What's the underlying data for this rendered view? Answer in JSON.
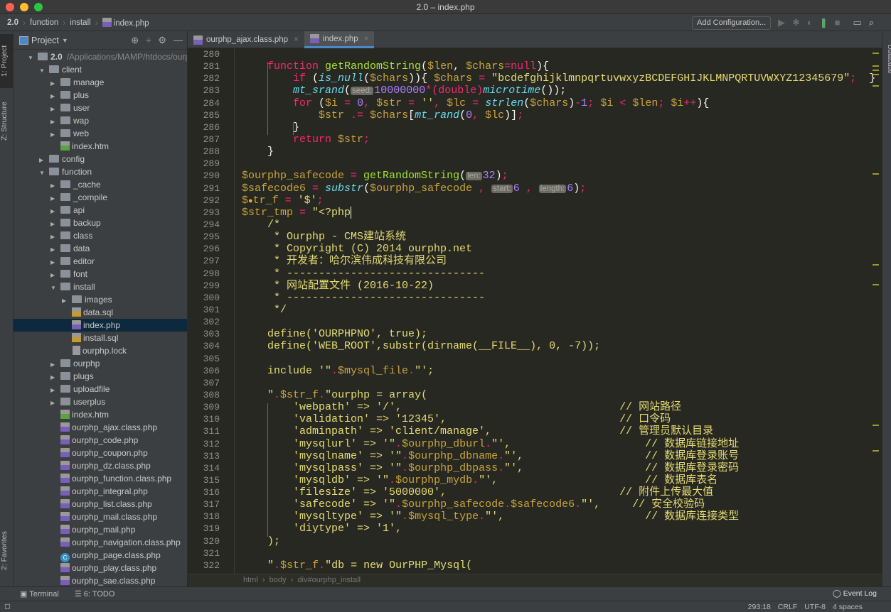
{
  "window": {
    "title": "2.0 – index.php",
    "lights": [
      "#ff5f57",
      "#febc2e",
      "#28c840"
    ]
  },
  "navbar": {
    "crumbs": [
      "2.0",
      "function",
      "install",
      "index.php"
    ],
    "add_configuration": "Add Configuration...",
    "icons": [
      "run-icon",
      "debug-icon",
      "coverage-icon",
      "database-sync-icon",
      "stop-icon",
      "terminal-window-icon",
      "search-icon"
    ]
  },
  "left_stripe": {
    "project": "1: Project",
    "structure": "Z: Structure",
    "favorites": "2: Favorites"
  },
  "right_stripe": {
    "database": "Database"
  },
  "project": {
    "title": "Project",
    "tree": [
      {
        "level": 0,
        "type": "folder",
        "open": true,
        "name": "2.0",
        "path": "/Applications/MAMP/htdocs/ourp"
      },
      {
        "level": 1,
        "type": "folder",
        "open": true,
        "name": "client"
      },
      {
        "level": 2,
        "type": "folder",
        "open": false,
        "name": "manage"
      },
      {
        "level": 2,
        "type": "folder",
        "open": false,
        "name": "plus"
      },
      {
        "level": 2,
        "type": "folder",
        "open": false,
        "name": "user"
      },
      {
        "level": 2,
        "type": "folder",
        "open": false,
        "name": "wap"
      },
      {
        "level": 2,
        "type": "folder",
        "open": false,
        "name": "web"
      },
      {
        "level": 2,
        "type": "htm",
        "name": "index.htm"
      },
      {
        "level": 1,
        "type": "folder",
        "open": false,
        "name": "config"
      },
      {
        "level": 1,
        "type": "folder",
        "open": true,
        "name": "function"
      },
      {
        "level": 2,
        "type": "folder",
        "open": false,
        "name": "_cache"
      },
      {
        "level": 2,
        "type": "folder",
        "open": false,
        "name": "_compile"
      },
      {
        "level": 2,
        "type": "folder",
        "open": false,
        "name": "api"
      },
      {
        "level": 2,
        "type": "folder",
        "open": false,
        "name": "backup"
      },
      {
        "level": 2,
        "type": "folder",
        "open": false,
        "name": "class"
      },
      {
        "level": 2,
        "type": "folder",
        "open": false,
        "name": "data"
      },
      {
        "level": 2,
        "type": "folder",
        "open": false,
        "name": "editor"
      },
      {
        "level": 2,
        "type": "folder",
        "open": false,
        "name": "font"
      },
      {
        "level": 2,
        "type": "folder",
        "open": true,
        "name": "install"
      },
      {
        "level": 3,
        "type": "folder",
        "open": false,
        "name": "images"
      },
      {
        "level": 3,
        "type": "sql",
        "name": "data.sql"
      },
      {
        "level": 3,
        "type": "php",
        "name": "index.php",
        "selected": true
      },
      {
        "level": 3,
        "type": "sql",
        "name": "install.sql"
      },
      {
        "level": 3,
        "type": "file",
        "name": "ourphp.lock"
      },
      {
        "level": 2,
        "type": "folder",
        "open": false,
        "name": "ourphp"
      },
      {
        "level": 2,
        "type": "folder",
        "open": false,
        "name": "plugs"
      },
      {
        "level": 2,
        "type": "folder",
        "open": false,
        "name": "uploadfile"
      },
      {
        "level": 2,
        "type": "folder",
        "open": false,
        "name": "userplus"
      },
      {
        "level": 2,
        "type": "htm",
        "name": "index.htm"
      },
      {
        "level": 2,
        "type": "php",
        "name": "ourphp_ajax.class.php"
      },
      {
        "level": 2,
        "type": "php",
        "name": "ourphp_code.php"
      },
      {
        "level": 2,
        "type": "php",
        "name": "ourphp_coupon.php"
      },
      {
        "level": 2,
        "type": "php",
        "name": "ourphp_dz.class.php"
      },
      {
        "level": 2,
        "type": "php",
        "name": "ourphp_function.class.php"
      },
      {
        "level": 2,
        "type": "php",
        "name": "ourphp_integral.php"
      },
      {
        "level": 2,
        "type": "php",
        "name": "ourphp_list.class.php"
      },
      {
        "level": 2,
        "type": "php",
        "name": "ourphp_mail.class.php"
      },
      {
        "level": 2,
        "type": "php",
        "name": "ourphp_mail.php"
      },
      {
        "level": 2,
        "type": "php",
        "name": "ourphp_navigation.class.php"
      },
      {
        "level": 2,
        "type": "class",
        "name": "ourphp_page.class.php"
      },
      {
        "level": 2,
        "type": "php",
        "name": "ourphp_play.class.php"
      },
      {
        "level": 2,
        "type": "php",
        "name": "ourphp_sae.class.php"
      }
    ]
  },
  "tabs": [
    {
      "label": "ourphp_ajax.class.php",
      "active": false
    },
    {
      "label": "index.php",
      "active": true
    }
  ],
  "editor": {
    "first_line": 280,
    "lines": [
      [],
      [
        [
          "",
          "    "
        ],
        [
          "k",
          "function "
        ],
        [
          "f",
          "getRandomString"
        ],
        [
          "p",
          "("
        ],
        [
          "v",
          "$len"
        ],
        [
          "p",
          ", "
        ],
        [
          "v",
          "$chars"
        ],
        [
          "o",
          "="
        ],
        [
          "k",
          "null"
        ],
        [
          "p",
          "){"
        ]
      ],
      [
        [
          "",
          "        "
        ],
        [
          "k",
          "if "
        ],
        [
          "p",
          "("
        ],
        [
          "i",
          "is_null"
        ],
        [
          "p",
          "("
        ],
        [
          "v",
          "$chars"
        ],
        [
          "p",
          "))"
        ],
        [
          "p",
          "{ "
        ],
        [
          "v",
          "$chars "
        ],
        [
          "o",
          "= "
        ],
        [
          "s",
          "\"bcdefghijklmnpqrtuvwxyzBCDEFGHIJKLMNPQRTUVWXYZ12345679\""
        ],
        [
          "o",
          "; "
        ],
        [
          "p",
          " }"
        ]
      ],
      [
        [
          "",
          "        "
        ],
        [
          "i",
          "mt_srand"
        ],
        [
          "p",
          "("
        ],
        [
          "h",
          "seed:"
        ],
        [
          "n",
          "10000000"
        ],
        [
          "o",
          "*"
        ],
        [
          "k",
          "(double)"
        ],
        [
          "i",
          "microtime"
        ],
        [
          "p",
          "());"
        ]
      ],
      [
        [
          "",
          "        "
        ],
        [
          "k",
          "for "
        ],
        [
          "p",
          "("
        ],
        [
          "v",
          "$i "
        ],
        [
          "o",
          "= "
        ],
        [
          "n",
          "0"
        ],
        [
          "o",
          ", "
        ],
        [
          "v",
          "$str "
        ],
        [
          "o",
          "= "
        ],
        [
          "s",
          "''"
        ],
        [
          "o",
          ", "
        ],
        [
          "v",
          "$lc "
        ],
        [
          "o",
          "= "
        ],
        [
          "i",
          "strlen"
        ],
        [
          "p",
          "("
        ],
        [
          "v",
          "$chars"
        ],
        [
          "p",
          ")"
        ],
        [
          "o",
          "-"
        ],
        [
          "n",
          "1"
        ],
        [
          "o",
          "; "
        ],
        [
          "v",
          "$i "
        ],
        [
          "o",
          "< "
        ],
        [
          "v",
          "$len"
        ],
        [
          "o",
          "; "
        ],
        [
          "v",
          "$i"
        ],
        [
          "o",
          "++"
        ],
        [
          "p",
          "){"
        ]
      ],
      [
        [
          "",
          "            "
        ],
        [
          "v",
          "$str "
        ],
        [
          "o",
          ".= "
        ],
        [
          "v",
          "$chars"
        ],
        [
          "p",
          "["
        ],
        [
          "i",
          "mt_rand"
        ],
        [
          "p",
          "("
        ],
        [
          "n",
          "0"
        ],
        [
          "o",
          ", "
        ],
        [
          "v",
          "$lc"
        ],
        [
          "p",
          ")]"
        ],
        [
          "o",
          ";"
        ]
      ],
      [
        [
          "",
          "        "
        ],
        [
          "p",
          "}"
        ]
      ],
      [
        [
          "",
          "        "
        ],
        [
          "k",
          "return "
        ],
        [
          "v",
          "$str"
        ],
        [
          "o",
          ";"
        ]
      ],
      [
        [
          "",
          "    "
        ],
        [
          "p",
          "}"
        ]
      ],
      [],
      [
        [
          "v",
          "$ourphp_safecode "
        ],
        [
          "o",
          "= "
        ],
        [
          "f",
          "getRandomString"
        ],
        [
          "p",
          "("
        ],
        [
          "h",
          "len:"
        ],
        [
          "n",
          "32"
        ],
        [
          "p",
          ")"
        ],
        [
          "o",
          ";"
        ]
      ],
      [
        [
          "v",
          "$safecode6 "
        ],
        [
          "o",
          "= "
        ],
        [
          "i",
          "substr"
        ],
        [
          "p",
          "("
        ],
        [
          "v",
          "$ourphp_safecode "
        ],
        [
          "o",
          ", "
        ],
        [
          "h",
          "start:"
        ],
        [
          "n",
          "6 "
        ],
        [
          "o",
          ", "
        ],
        [
          "h",
          "length:"
        ],
        [
          "n",
          "6"
        ],
        [
          "p",
          ")"
        ],
        [
          "o",
          ";"
        ]
      ],
      [
        [
          "v",
          "$"
        ],
        [
          "bulb",
          "●"
        ],
        [
          "v",
          "tr_f "
        ],
        [
          "o",
          "= "
        ],
        [
          "s",
          "'$'"
        ],
        [
          "o",
          ";"
        ]
      ],
      [
        [
          "v",
          "$str_tmp "
        ],
        [
          "o",
          "= "
        ],
        [
          "s",
          "\"<?php"
        ],
        [
          "caret",
          ""
        ]
      ],
      [
        [
          "s",
          "    /*"
        ]
      ],
      [
        [
          "s",
          "     * Ourphp - CMS建站系统"
        ]
      ],
      [
        [
          "s",
          "     * Copyright (C) 2014 ourphp.net"
        ]
      ],
      [
        [
          "s",
          "     * 开发者：哈尔滨伟成科技有限公司"
        ]
      ],
      [
        [
          "s",
          "     * -------------------------------"
        ]
      ],
      [
        [
          "s",
          "     * 网站配置文件 (2016-10-22)"
        ]
      ],
      [
        [
          "s",
          "     * -------------------------------"
        ]
      ],
      [
        [
          "s",
          "     */"
        ]
      ],
      [],
      [
        [
          "s",
          "    define('OURPHPNO', true);"
        ]
      ],
      [
        [
          "s",
          "    define('WEB_ROOT',substr(dirname(__FILE__), 0, -7));"
        ]
      ],
      [],
      [
        [
          "s",
          "    include '\""
        ],
        [
          "o",
          "."
        ],
        [
          "v",
          "$mysql_file"
        ],
        [
          "o",
          "."
        ],
        [
          "s",
          "\"';"
        ]
      ],
      [],
      [
        [
          "s",
          "    \""
        ],
        [
          "o",
          "."
        ],
        [
          "v",
          "$str_f"
        ],
        [
          "o",
          "."
        ],
        [
          "s",
          "\"ourphp = array("
        ]
      ],
      [
        [
          "s",
          "        'webpath' => '/',                                  // 网站路径"
        ]
      ],
      [
        [
          "s",
          "        'validation' => '12345',                           // 口令码"
        ]
      ],
      [
        [
          "s",
          "        'adminpath' => 'client/manage',                    // 管理员默认目录"
        ]
      ],
      [
        [
          "s",
          "        'mysqlurl' => '\""
        ],
        [
          "o",
          "."
        ],
        [
          "v",
          "$ourphp_dburl"
        ],
        [
          "o",
          "."
        ],
        [
          "s",
          "\"',                     // 数据库链接地址"
        ]
      ],
      [
        [
          "s",
          "        'mysqlname' => '\""
        ],
        [
          "o",
          "."
        ],
        [
          "v",
          "$ourphp_dbname"
        ],
        [
          "o",
          "."
        ],
        [
          "s",
          "\"',                   // 数据库登录账号"
        ]
      ],
      [
        [
          "s",
          "        'mysqlpass' => '\""
        ],
        [
          "o",
          "."
        ],
        [
          "v",
          "$ourphp_dbpass"
        ],
        [
          "o",
          "."
        ],
        [
          "s",
          "\"',                   // 数据库登录密码"
        ]
      ],
      [
        [
          "s",
          "        'mysqldb' => '\""
        ],
        [
          "o",
          "."
        ],
        [
          "v",
          "$ourphp_mydb"
        ],
        [
          "o",
          "."
        ],
        [
          "s",
          "\"',                       // 数据库表名"
        ]
      ],
      [
        [
          "s",
          "        'filesize' => '5000000',                           // 附件上传最大值"
        ]
      ],
      [
        [
          "s",
          "        'safecode' => '\""
        ],
        [
          "o",
          "."
        ],
        [
          "v",
          "$ourphp_safecode"
        ],
        [
          "o",
          "."
        ],
        [
          "v",
          "$safecode6"
        ],
        [
          "o",
          "."
        ],
        [
          "s",
          "\"',     // 安全校验码"
        ]
      ],
      [
        [
          "s",
          "        'mysqltype' => '\""
        ],
        [
          "o",
          "."
        ],
        [
          "v",
          "$mysql_type"
        ],
        [
          "o",
          "."
        ],
        [
          "s",
          "\"',                      // 数据库连接类型"
        ]
      ],
      [
        [
          "s",
          "        'diytype' => '1',"
        ]
      ],
      [
        [
          "s",
          "    );"
        ]
      ],
      [],
      [
        [
          "s",
          "    \""
        ],
        [
          "o",
          "."
        ],
        [
          "v",
          "$str_f"
        ],
        [
          "o",
          "."
        ],
        [
          "s",
          "\"db = new OurPHP_Mysql("
        ]
      ]
    ]
  },
  "editor_breadcrumb": [
    "html",
    "body",
    "div#ourphp_install"
  ],
  "bottom_tools": {
    "terminal": "Terminal",
    "todo": "6: TODO"
  },
  "event_log": "Event Log",
  "status": {
    "position": "293:18",
    "line_sep": "CRLF",
    "encoding": "UTF-8",
    "indent": "4 spaces"
  }
}
